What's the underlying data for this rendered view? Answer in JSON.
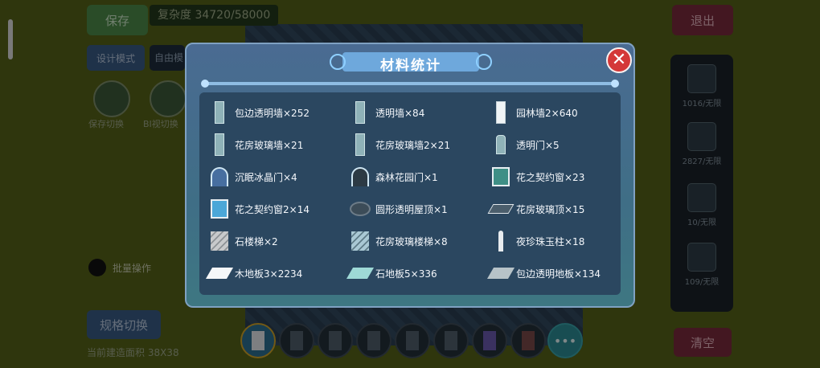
{
  "hud": {
    "save_label": "保存",
    "complexity": "复杂度 34720/58000",
    "design_mode_label": "设计模式",
    "mode_value": "自由模",
    "toggle_1_label": "保存切换",
    "toggle_2_label": "BI视切换",
    "radio_label": "批量操作",
    "grid_switch_label": "规格切换",
    "area_label": "当前建造面积 38X38",
    "exit_label": "退出",
    "clear_label": "清空"
  },
  "right_panel": [
    {
      "label": "1016/无限",
      "icon": "wall-icon"
    },
    {
      "label": "2827/无限",
      "icon": "grid-icon"
    },
    {
      "label": "10/无限",
      "icon": "door-icon"
    },
    {
      "label": "109/无限",
      "icon": "pillar-icon"
    }
  ],
  "toolbar": {
    "more_label": "•••",
    "slots": [
      "eraser-icon",
      "wall-icon",
      "wall-icon",
      "wall-icon",
      "wall-icon",
      "window-icon",
      "window-icon",
      "window-icon"
    ]
  },
  "modal": {
    "title": "材料统计",
    "close_label": "✕",
    "items": [
      {
        "text": "包边透明墙×252",
        "icon": "glass-wall-icon"
      },
      {
        "text": "透明墙×84",
        "icon": "glass-wall-icon"
      },
      {
        "text": "园林墙2×640",
        "icon": "white-wall-icon"
      },
      {
        "text": "花房玻璃墙×21",
        "icon": "glass-wall-icon"
      },
      {
        "text": "花房玻璃墙2×21",
        "icon": "glass-wall-icon"
      },
      {
        "text": "透明门×5",
        "icon": "door-icon"
      },
      {
        "text": "沉眠冰晶门×4",
        "icon": "arch-door-icon"
      },
      {
        "text": "森林花园门×1",
        "icon": "arch-door-icon"
      },
      {
        "text": "花之契约窗×23",
        "icon": "window-icon"
      },
      {
        "text": "花之契约窗2×14",
        "icon": "window-icon"
      },
      {
        "text": "圆形透明屋顶×1",
        "icon": "round-roof-icon"
      },
      {
        "text": "花房玻璃顶×15",
        "icon": "roof-icon"
      },
      {
        "text": "石楼梯×2",
        "icon": "stairs-icon"
      },
      {
        "text": "花房玻璃楼梯×8",
        "icon": "stairs-icon"
      },
      {
        "text": "夜珍珠玉柱×18",
        "icon": "pillar-icon"
      },
      {
        "text": "木地板3×2234",
        "icon": "floor-icon"
      },
      {
        "text": "石地板5×336",
        "icon": "floor-icon"
      },
      {
        "text": "包边透明地板×134",
        "icon": "floor-icon"
      }
    ]
  }
}
